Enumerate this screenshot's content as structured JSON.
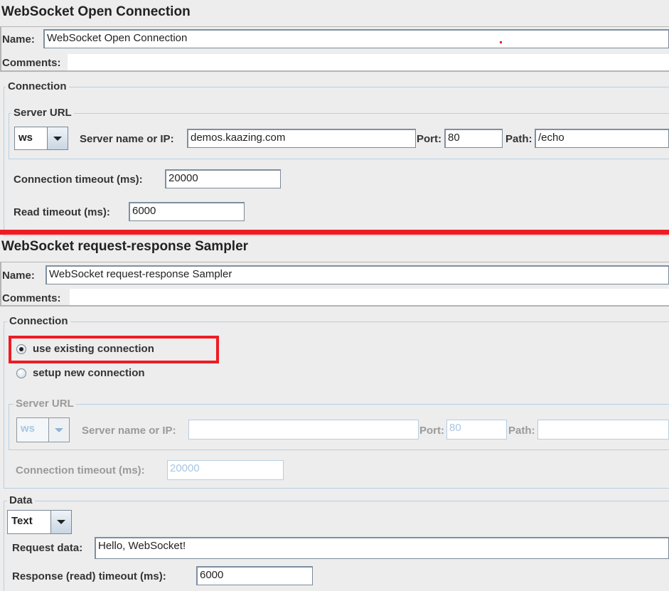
{
  "open_connection": {
    "title": "WebSocket Open Connection",
    "name_label": "Name:",
    "name_value": "WebSocket Open Connection",
    "comments_label": "Comments:",
    "comments_value": "",
    "connection_legend": "Connection",
    "server_url_legend": "Server URL",
    "protocol_value": "ws",
    "server_label": "Server name or IP:",
    "server_value": "demos.kaazing.com",
    "port_label": "Port:",
    "port_value": "80",
    "path_label": "Path:",
    "path_value": "/echo",
    "conn_timeout_label": "Connection timeout (ms):",
    "conn_timeout_value": "20000",
    "read_timeout_label": "Read timeout (ms):",
    "read_timeout_value": "6000"
  },
  "request_response": {
    "title": "WebSocket request-response Sampler",
    "name_label": "Name:",
    "name_value": "WebSocket request-response Sampler",
    "comments_label": "Comments:",
    "comments_value": "",
    "connection_legend": "Connection",
    "radio_options": [
      {
        "label": "use existing connection",
        "selected": true
      },
      {
        "label": "setup new connection",
        "selected": false
      }
    ],
    "server_url_legend": "Server URL",
    "protocol_value": "ws",
    "server_label": "Server name or IP:",
    "server_value": "",
    "port_label": "Port:",
    "port_value": "80",
    "path_label": "Path:",
    "path_value": "",
    "conn_timeout_label": "Connection timeout (ms):",
    "conn_timeout_value": "20000",
    "data_legend": "Data",
    "data_type_value": "Text",
    "request_data_label": "Request data:",
    "request_data_value": "Hello, WebSocket!",
    "response_timeout_label": "Response (read) timeout (ms):",
    "response_timeout_value": "6000"
  },
  "annotations": {
    "highlight_color": "#ed1c24"
  }
}
